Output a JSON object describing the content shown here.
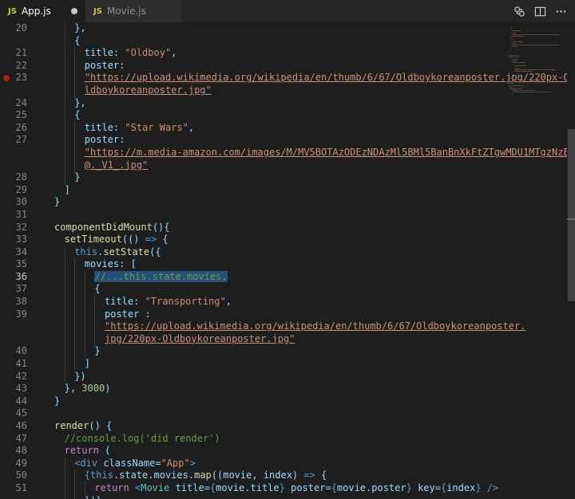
{
  "tabs": [
    {
      "badge": "JS",
      "label": "App.js",
      "modified": true,
      "active": true
    },
    {
      "badge": "JS",
      "label": "Movie.js",
      "modified": false,
      "active": false
    }
  ],
  "editor": {
    "breakpoint_line": "23",
    "current_line": "36",
    "lines": [
      {
        "num": "20",
        "ind": 2,
        "t": [
          [
            "p",
            "},"
          ]
        ]
      },
      {
        "num": "",
        "ind": 2,
        "t": [
          [
            "p",
            "{"
          ]
        ]
      },
      {
        "num": "21",
        "ind": 3,
        "t": [
          [
            "p",
            "title: "
          ],
          [
            "s",
            "\"Oldboy\""
          ],
          [
            "p",
            ","
          ]
        ]
      },
      {
        "num": "22",
        "ind": 3,
        "t": [
          [
            "p",
            "poster:"
          ]
        ]
      },
      {
        "num": "23",
        "ind": 3,
        "t": [
          [
            "su",
            "\"https://upload.wikimedia.org/wikipedia/en/thumb/6/67/Oldboykoreanposter.jpg/220px-O"
          ]
        ]
      },
      {
        "num": "",
        "ind": 3,
        "t": [
          [
            "su",
            "ldboykoreanposter.jpg\""
          ]
        ]
      },
      {
        "num": "24",
        "ind": 2,
        "t": [
          [
            "p",
            "},"
          ]
        ]
      },
      {
        "num": "25",
        "ind": 2,
        "t": [
          [
            "p",
            "{"
          ]
        ]
      },
      {
        "num": "26",
        "ind": 3,
        "t": [
          [
            "p",
            "title: "
          ],
          [
            "s",
            "\"Star Wars\""
          ],
          [
            "p",
            ","
          ]
        ]
      },
      {
        "num": "27",
        "ind": 3,
        "t": [
          [
            "p",
            "poster:"
          ]
        ]
      },
      {
        "num": "",
        "ind": 3,
        "t": [
          [
            "su",
            "\"https://m.media-amazon.com/images/M/MV5BOTAzODEzNDAzMl5BMl5BanBnXkFtZTgwMDU1MTgzNzE"
          ]
        ]
      },
      {
        "num": "",
        "ind": 3,
        "t": [
          [
            "su",
            "@._V1_.jpg\""
          ]
        ]
      },
      {
        "num": "28",
        "ind": 2,
        "t": [
          [
            "p",
            "}"
          ]
        ]
      },
      {
        "num": "29",
        "ind": 1,
        "t": [
          [
            "p",
            "]"
          ]
        ]
      },
      {
        "num": "30",
        "ind": 0,
        "t": [
          [
            "p",
            "}"
          ]
        ]
      },
      {
        "num": "31",
        "ind": 0,
        "t": []
      },
      {
        "num": "32",
        "ind": 0,
        "t": [
          [
            "f",
            "componentDidMount"
          ],
          [
            "p",
            "(){"
          ]
        ]
      },
      {
        "num": "33",
        "ind": 1,
        "t": [
          [
            "f",
            "setTimeout"
          ],
          [
            "p",
            "(() "
          ],
          [
            "k",
            "=>"
          ],
          [
            "p",
            " {"
          ]
        ]
      },
      {
        "num": "34",
        "ind": 2,
        "t": [
          [
            "k",
            "this"
          ],
          [
            "p",
            "."
          ],
          [
            "f",
            "setState"
          ],
          [
            "p",
            "({"
          ]
        ]
      },
      {
        "num": "35",
        "ind": 3,
        "t": [
          [
            "p",
            "movies: ["
          ]
        ]
      },
      {
        "num": "36",
        "ind": 4,
        "t": [
          [
            "cs",
            "//...this.state.movies,"
          ]
        ]
      },
      {
        "num": "37",
        "ind": 4,
        "t": [
          [
            "p",
            "{"
          ]
        ]
      },
      {
        "num": "38",
        "ind": 5,
        "t": [
          [
            "p",
            "title: "
          ],
          [
            "s",
            "\"Transporting\""
          ],
          [
            "p",
            ","
          ]
        ]
      },
      {
        "num": "39",
        "ind": 5,
        "t": [
          [
            "p",
            "poster :"
          ]
        ]
      },
      {
        "num": "",
        "ind": 5,
        "t": [
          [
            "su",
            "\"https://upload.wikimedia.org/wikipedia/en/thumb/6/67/Oldboykoreanposter."
          ]
        ]
      },
      {
        "num": "",
        "ind": 5,
        "t": [
          [
            "su",
            "jpg/220px-Oldboykoreanposter.jpg\""
          ]
        ]
      },
      {
        "num": "40",
        "ind": 4,
        "t": [
          [
            "p",
            "}"
          ]
        ]
      },
      {
        "num": "41",
        "ind": 3,
        "t": [
          [
            "p",
            "]"
          ]
        ]
      },
      {
        "num": "42",
        "ind": 2,
        "t": [
          [
            "p",
            "})"
          ]
        ]
      },
      {
        "num": "43",
        "ind": 1,
        "t": [
          [
            "p",
            "}, "
          ],
          [
            "n",
            "3000"
          ],
          [
            "p",
            ")"
          ]
        ]
      },
      {
        "num": "44",
        "ind": 0,
        "t": [
          [
            "p",
            "}"
          ]
        ]
      },
      {
        "num": "45",
        "ind": 0,
        "t": []
      },
      {
        "num": "46",
        "ind": 0,
        "t": [
          [
            "f",
            "render"
          ],
          [
            "p",
            "() {"
          ]
        ]
      },
      {
        "num": "47",
        "ind": 1,
        "t": [
          [
            "c",
            "//console.log('did render')"
          ]
        ]
      },
      {
        "num": "48",
        "ind": 1,
        "t": [
          [
            "kc",
            "return"
          ],
          [
            "p",
            " ("
          ]
        ]
      },
      {
        "num": "49",
        "ind": 2,
        "t": [
          [
            "k",
            "<div"
          ],
          [
            "p",
            " className="
          ],
          [
            "s",
            "\"App\""
          ],
          [
            "k",
            ">"
          ]
        ]
      },
      {
        "num": "50",
        "ind": 3,
        "t": [
          [
            "k",
            "{"
          ],
          [
            "k",
            "this"
          ],
          [
            "p",
            ".state.movies."
          ],
          [
            "f",
            "map"
          ],
          [
            "p",
            "((movie, index) "
          ],
          [
            "k",
            "=>"
          ],
          [
            "p",
            " {"
          ]
        ]
      },
      {
        "num": "51",
        "ind": 4,
        "t": [
          [
            "kc",
            "return"
          ],
          [
            "p",
            " "
          ],
          [
            "k",
            "<"
          ],
          [
            "t",
            "Movie"
          ],
          [
            "p",
            " title="
          ],
          [
            "k",
            "{"
          ],
          [
            "p",
            "movie.title"
          ],
          [
            "k",
            "}"
          ],
          [
            "p",
            " poster="
          ],
          [
            "k",
            "{"
          ],
          [
            "p",
            "movie.poster"
          ],
          [
            "k",
            "}"
          ],
          [
            "p",
            " key="
          ],
          [
            "k",
            "{"
          ],
          [
            "p",
            "index"
          ],
          [
            "k",
            "}"
          ],
          [
            "p",
            " "
          ],
          [
            "k",
            "/>"
          ]
        ]
      },
      {
        "num": "",
        "ind": 3,
        "t": [
          [
            "p",
            "})}"
          ]
        ]
      }
    ]
  }
}
